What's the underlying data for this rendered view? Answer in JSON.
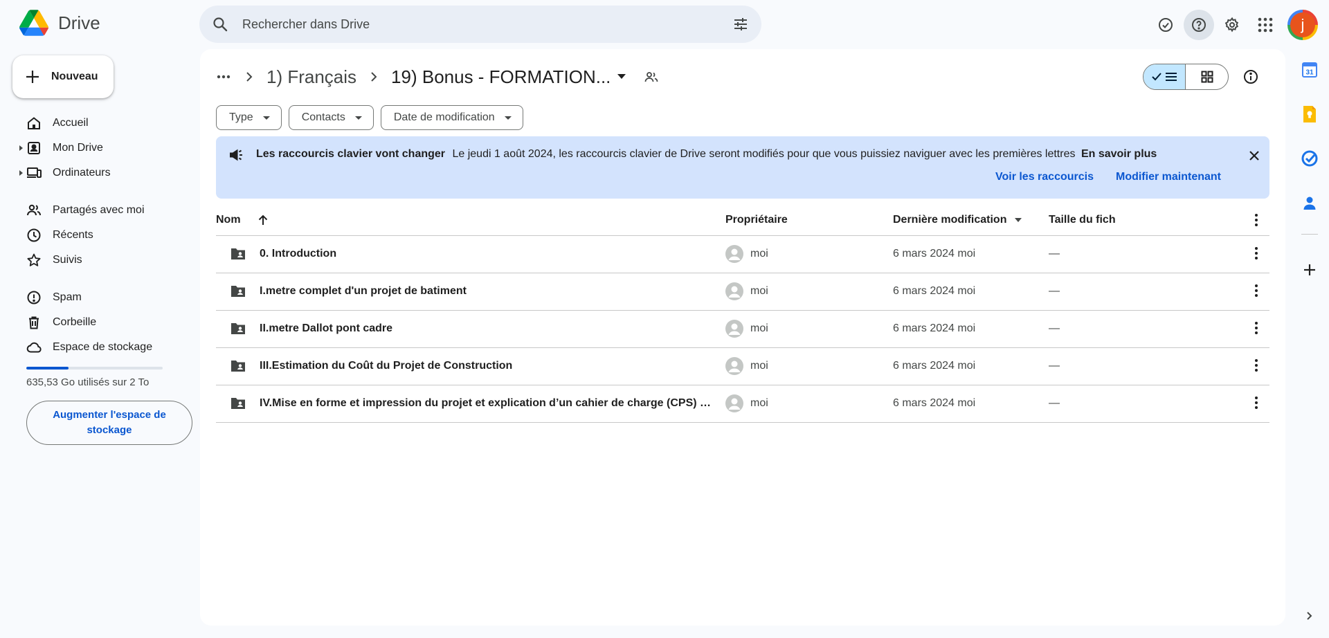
{
  "app": {
    "name": "Drive"
  },
  "search": {
    "placeholder": "Rechercher dans Drive"
  },
  "sidebar": {
    "new_label": "Nouveau",
    "items": [
      {
        "label": "Accueil",
        "icon": "home-icon"
      },
      {
        "label": "Mon Drive",
        "icon": "my-drive-icon"
      },
      {
        "label": "Ordinateurs",
        "icon": "computers-icon"
      },
      {
        "label": "Partagés avec moi",
        "icon": "shared-icon"
      },
      {
        "label": "Récents",
        "icon": "clock-icon"
      },
      {
        "label": "Suivis",
        "icon": "star-icon"
      },
      {
        "label": "Spam",
        "icon": "spam-icon"
      },
      {
        "label": "Corbeille",
        "icon": "trash-icon"
      },
      {
        "label": "Espace de stockage",
        "icon": "cloud-icon"
      }
    ],
    "storage": {
      "used_fraction": 0.31,
      "text": "635,53 Go utilisés sur 2 To"
    },
    "upgrade_label": "Augmenter l'espace de stockage"
  },
  "breadcrumb": {
    "parent": "1) Français",
    "current": "19) Bonus - FORMATION..."
  },
  "filters": [
    {
      "label": "Type"
    },
    {
      "label": "Contacts"
    },
    {
      "label": "Date de modification"
    }
  ],
  "banner": {
    "title": "Les raccourcis clavier vont changer",
    "text": "Le jeudi 1 août 2024, les raccourcis clavier de Drive seront modifiés pour que vous puissiez naviguer avec les premières lettres",
    "learn_more": "En savoir plus",
    "action_view": "Voir les raccourcis",
    "action_modify": "Modifier maintenant"
  },
  "table": {
    "headers": {
      "name": "Nom",
      "owner": "Propriétaire",
      "modified": "Dernière modification",
      "size": "Taille du fich"
    },
    "rows": [
      {
        "name": "0. Introduction",
        "owner": "moi",
        "modified": "6 mars 2024  moi",
        "size": "—"
      },
      {
        "name": "I.metre complet d'un projet de batiment",
        "owner": "moi",
        "modified": "6 mars 2024  moi",
        "size": "—"
      },
      {
        "name": "II.metre Dallot pont cadre",
        "owner": "moi",
        "modified": "6 mars 2024  moi",
        "size": "—"
      },
      {
        "name": "III.Estimation du Coût du Projet de Construction",
        "owner": "moi",
        "modified": "6 mars 2024  moi",
        "size": "—"
      },
      {
        "name": "IV.Mise en forme et impression du projet et explication d’un cahier de charge (CPS) po...",
        "owner": "moi",
        "modified": "6 mars 2024  moi",
        "size": "—"
      }
    ]
  },
  "account": {
    "initial": "j"
  },
  "rail": {
    "calendar_day": "31"
  },
  "colors": {
    "accent": "#0b57d0",
    "banner_bg": "#d3e3fd",
    "selected_toggle": "#c2e7ff"
  }
}
